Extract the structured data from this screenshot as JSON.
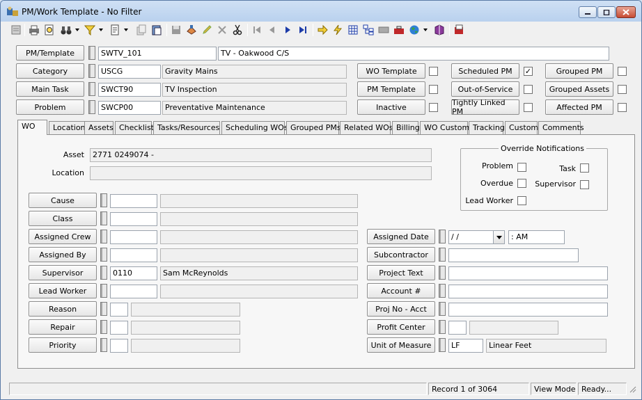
{
  "window": {
    "title": "PM/Work Template - No Filter"
  },
  "header_rows": [
    {
      "button": "PM/Template",
      "code": "SWTV_101",
      "desc": "TV - Oakwood C/S"
    },
    {
      "button": "Category",
      "code": "USCG",
      "desc": "Gravity Mains"
    },
    {
      "button": "Main Task",
      "code": "SWCT90",
      "desc": "TV Inspection"
    },
    {
      "button": "Problem",
      "code": "SWCP00",
      "desc": "Preventative Maintenance"
    }
  ],
  "flags": [
    {
      "label": "WO Template",
      "checked": ""
    },
    {
      "label": "PM Template",
      "checked": ""
    },
    {
      "label": "Inactive",
      "checked": ""
    },
    {
      "label": "Scheduled PM",
      "checked": "✓"
    },
    {
      "label": "Out-of-Service",
      "checked": ""
    },
    {
      "label": "Tightly Linked PM",
      "checked": ""
    },
    {
      "label": "Grouped PM",
      "checked": ""
    },
    {
      "label": "Grouped Assets",
      "checked": ""
    },
    {
      "label": "Affected PM",
      "checked": ""
    }
  ],
  "tabs": [
    "WO",
    "Location",
    "Assets",
    "Checklist",
    "Tasks/Resources",
    "Scheduling WOs",
    "Grouped PMs",
    "Related WOs",
    "Billing",
    "WO Custom",
    "Tracking",
    "Custom",
    "Comments"
  ],
  "wo": {
    "asset_label": "Asset",
    "asset_value": "2771 0249074 -",
    "location_label": "Location",
    "location_value": "",
    "left_rows": [
      {
        "button": "Cause",
        "code": "",
        "desc": ""
      },
      {
        "button": "Class",
        "code": "",
        "desc": ""
      },
      {
        "button": "Assigned Crew",
        "code": "",
        "desc": ""
      },
      {
        "button": "Assigned By",
        "code": "",
        "desc": ""
      },
      {
        "button": "Supervisor",
        "code": "0110",
        "desc": "Sam McReynolds"
      },
      {
        "button": "Lead Worker",
        "code": "",
        "desc": ""
      },
      {
        "button": "Reason",
        "code": "",
        "desc": ""
      },
      {
        "button": "Repair",
        "code": "",
        "desc": ""
      },
      {
        "button": "Priority",
        "code": "",
        "desc": ""
      }
    ],
    "right_rows": [
      {
        "button": "Assigned Date",
        "date": " /  /",
        "time": "  :  AM"
      },
      {
        "button": "Subcontractor",
        "value": ""
      },
      {
        "button": "Project Text",
        "value": ""
      },
      {
        "button": "Account #",
        "value": ""
      },
      {
        "button": "Proj No - Acct",
        "value": ""
      },
      {
        "button": "Profit Center",
        "code": "",
        "desc": ""
      },
      {
        "button": "Unit of Measure",
        "code": "LF",
        "desc": "Linear Feet"
      }
    ],
    "override": {
      "title": "Override Notifications",
      "items": [
        {
          "label": "Problem",
          "checked": ""
        },
        {
          "label": "Task",
          "checked": ""
        },
        {
          "label": "Overdue",
          "checked": ""
        },
        {
          "label": "Supervisor",
          "checked": ""
        },
        {
          "label": "Lead Worker",
          "checked": ""
        }
      ]
    }
  },
  "status": {
    "record": "Record 1 of 3064",
    "mode": "View Mode",
    "state": "Ready..."
  },
  "toolbar_icons": [
    "new-icon",
    "print-icon",
    "preview-icon",
    "binoculars-icon",
    "filter-icon",
    "report-icon",
    "copy-icon",
    "paste-icon",
    "save-icon",
    "stamp-icon",
    "edit-icon",
    "delete-icon",
    "cut-icon",
    "first-record-icon",
    "prev-record-icon",
    "next-record-icon",
    "last-record-icon",
    "goto-icon",
    "lightning-icon",
    "grid-icon",
    "tree-icon",
    "calculator-icon",
    "toolbox-icon",
    "globe-icon",
    "book-icon",
    "exit-icon"
  ]
}
